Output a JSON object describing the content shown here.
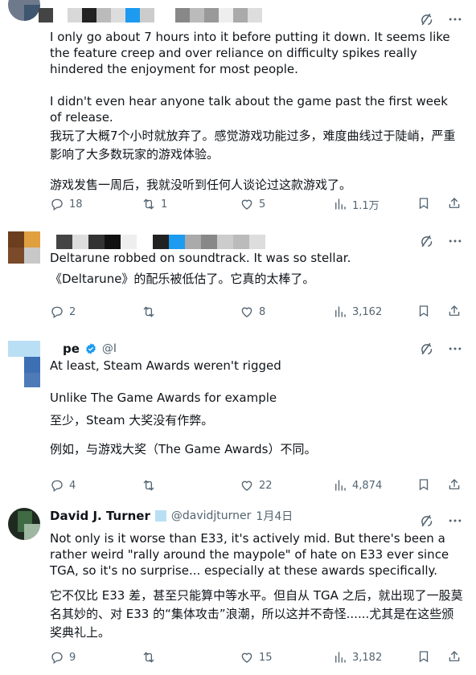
{
  "tweets": [
    {
      "name": "",
      "handle": "",
      "text_en": [
        "I only go about 7 hours into it before putting it down. It seems like the feature creep and over reliance on difficulty spikes really hindered the enjoyment for most people.",
        "I didn't even hear anyone talk about the game past the first week of release."
      ],
      "text_zh": [
        "我玩了大概7个小时就放弃了。感觉游戏功能过多，难度曲线过于陡峭，严重影响了大多数玩家的游戏体验。",
        "游戏发售一周后，我就没听到任何人谈论过这款游戏了。"
      ],
      "replies": "18",
      "retweets": "1",
      "likes": "5",
      "views": "1.1万"
    },
    {
      "name": "",
      "handle": "",
      "text_en": [
        "Deltarune robbed on soundtrack. It was so stellar."
      ],
      "text_zh": [
        "《Deltarune》的配乐被低估了。它真的太棒了。"
      ],
      "replies": "2",
      "retweets": "",
      "likes": "8",
      "views": "3,162"
    },
    {
      "name": "pe",
      "handle": "@I",
      "text_en": [
        "At least, Steam Awards weren't rigged",
        "Unlike The Game Awards for example"
      ],
      "text_zh": [
        "至少，Steam 大奖没有作弊。",
        "例如，与游戏大奖（The Game Awards）不同。"
      ],
      "replies": "4",
      "retweets": "",
      "likes": "22",
      "views": "4,874"
    },
    {
      "name": "David J. Turner",
      "handle": "@davidjturner",
      "date": "1月4日",
      "text_en": [
        "Not only is it worse than E33, it's actively mid. But there's been a rather weird \"rally around the maypole\" of hate on E33 ever since TGA, so it's no surprise... especially at these awards specifically."
      ],
      "text_zh": [
        "它不仅比 E33 差，甚至只能算中等水平。但自从 TGA 之后，就出现了一股莫名其妙的、对 E33 的“集体攻击”浪潮，所以这并不奇怪......尤其是在这些颁奖典礼上。"
      ],
      "replies": "9",
      "retweets": "",
      "likes": "15",
      "views": "3,182"
    }
  ],
  "colors": {
    "text": "#0f1419",
    "muted": "#536471",
    "border": "#eff3f4",
    "verified": "#1d9bf0"
  },
  "icons": [
    "grok-icon",
    "more-icon",
    "reply-icon",
    "retweet-icon",
    "like-icon",
    "views-icon",
    "bookmark-icon",
    "share-icon",
    "verified-icon"
  ]
}
